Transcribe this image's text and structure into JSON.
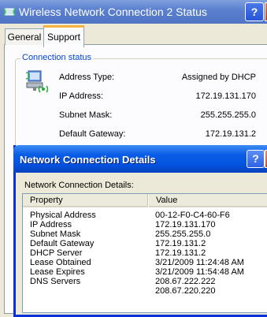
{
  "back_window": {
    "title": "Wireless Network Connection 2 Status",
    "help_glyph": "?",
    "tabs": [
      {
        "label": "General"
      },
      {
        "label": "Support"
      }
    ],
    "connection_status": {
      "group_label": "Connection status",
      "rows": [
        {
          "label": "Address Type:",
          "value": "Assigned by DHCP"
        },
        {
          "label": "IP Address:",
          "value": "172.19.131.170"
        },
        {
          "label": "Subnet Mask:",
          "value": "255.255.255.0"
        },
        {
          "label": "Default Gateway:",
          "value": "172.19.131.2"
        }
      ]
    }
  },
  "details_dialog": {
    "title": "Network Connection Details",
    "help_glyph": "?",
    "subtitle": "Network Connection Details:",
    "columns": {
      "property": "Property",
      "value": "Value"
    },
    "rows": [
      {
        "property": "Physical Address",
        "value": "00-12-F0-C4-60-F6"
      },
      {
        "property": "IP Address",
        "value": "172.19.131.170"
      },
      {
        "property": "Subnet Mask",
        "value": "255.255.255.0"
      },
      {
        "property": "Default Gateway",
        "value": "172.19.131.2"
      },
      {
        "property": "DHCP Server",
        "value": "172.19.131.2"
      },
      {
        "property": "Lease Obtained",
        "value": "3/21/2009 11:24:48 AM"
      },
      {
        "property": "Lease Expires",
        "value": "3/21/2009 11:54:48 AM"
      },
      {
        "property": "DNS Servers",
        "value": "208.67.222.222"
      },
      {
        "property": "",
        "value": "208.67.220.220"
      }
    ]
  },
  "colors": {
    "window_face": "#ece9d8",
    "group_label": "#0046d5",
    "active_titlebar": "#0454e0",
    "inactive_titlebar": "#5b80cf",
    "selected_tab_accent": "#f5b23c"
  }
}
